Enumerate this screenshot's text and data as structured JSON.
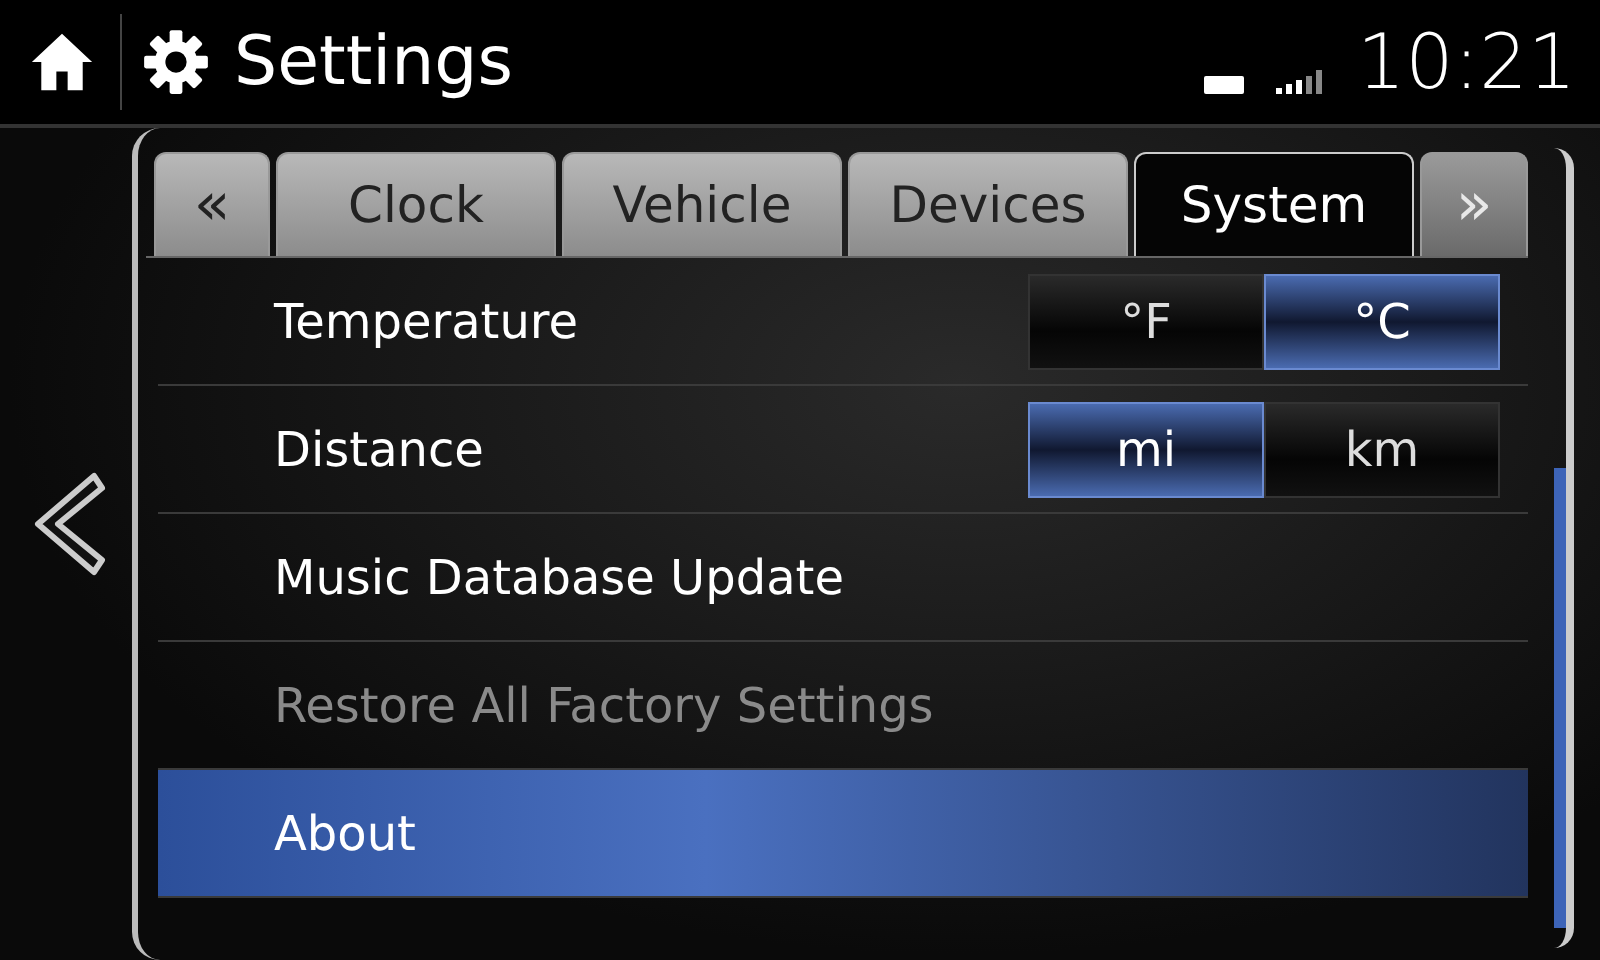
{
  "header": {
    "title": "Settings",
    "time": "10:21"
  },
  "tabs": [
    {
      "label": "«",
      "kind": "arrow",
      "selected": false,
      "disabled": false
    },
    {
      "label": "Clock",
      "kind": "tab",
      "selected": false,
      "disabled": false
    },
    {
      "label": "Vehicle",
      "kind": "tab",
      "selected": false,
      "disabled": false
    },
    {
      "label": "Devices",
      "kind": "tab",
      "selected": false,
      "disabled": false
    },
    {
      "label": "System",
      "kind": "tab",
      "selected": true,
      "disabled": false
    },
    {
      "label": "»",
      "kind": "arrow",
      "selected": false,
      "disabled": true
    }
  ],
  "rows": [
    {
      "kind": "toggle",
      "label": "Temperature",
      "disabled": false,
      "selected": false,
      "options": [
        {
          "label": "°F",
          "selected": false
        },
        {
          "label": "°C",
          "selected": true
        }
      ]
    },
    {
      "kind": "toggle",
      "label": "Distance",
      "disabled": false,
      "selected": false,
      "options": [
        {
          "label": "mi",
          "selected": true
        },
        {
          "label": "km",
          "selected": false
        }
      ]
    },
    {
      "kind": "item",
      "label": "Music Database Update",
      "disabled": false,
      "selected": false
    },
    {
      "kind": "item",
      "label": "Restore All Factory Settings",
      "disabled": true,
      "selected": false
    },
    {
      "kind": "item",
      "label": "About",
      "disabled": false,
      "selected": true
    }
  ]
}
